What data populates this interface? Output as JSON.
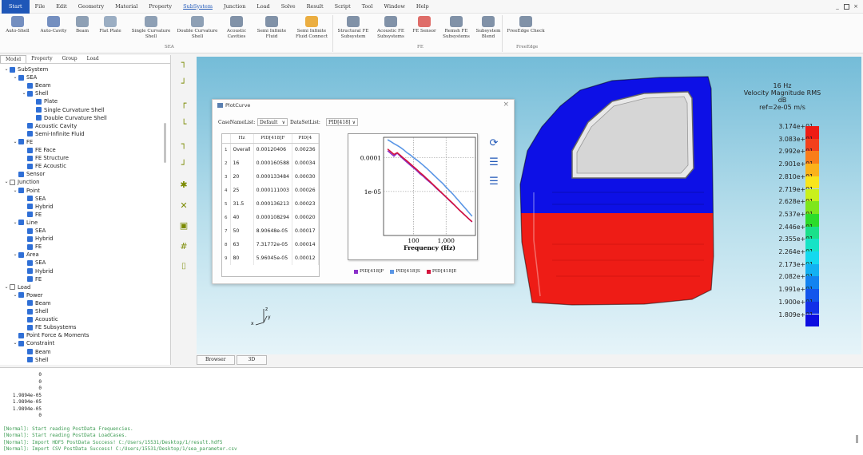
{
  "menu": {
    "items": [
      "Start",
      "File",
      "Edit",
      "Geometry",
      "Material",
      "Property",
      "SubSystem",
      "Junction",
      "Load",
      "Solve",
      "Result",
      "Script",
      "Tool",
      "Window",
      "Help"
    ],
    "window_buttons": [
      "_",
      "×"
    ]
  },
  "ribbon": {
    "buttons": [
      {
        "label": "Auto-Shell",
        "icon": "auto-shell-icon",
        "color": "#5c7bb5"
      },
      {
        "label": "Auto-Cavity",
        "icon": "auto-cavity-icon",
        "color": "#5c7bb5"
      },
      {
        "label": "Beam",
        "icon": "beam-icon",
        "color": "#7a8fa8"
      },
      {
        "label": "Flat Plate",
        "icon": "flat-plate-icon",
        "color": "#8aa0b8"
      },
      {
        "label": "Single Curvature Shell",
        "icon": "single-curvature-shell-icon",
        "color": "#7a8fa8"
      },
      {
        "label": "Double Curvature Shell",
        "icon": "double-curvature-shell-icon",
        "color": "#7a8fa8"
      },
      {
        "label": "Acoustic Cavities",
        "icon": "acoustic-cavities-icon",
        "color": "#6b7f99"
      },
      {
        "label": "Semi Infinite Fluid",
        "icon": "semi-infinite-fluid-icon",
        "color": "#6b7f99"
      },
      {
        "label": "Semi Infinite Fluid Connect",
        "icon": "semi-infinite-fluid-connect-icon",
        "color": "#e8a020"
      },
      {
        "label": "Structural FE Subsystem",
        "icon": "structural-fe-subsystem-icon",
        "color": "#6b7f99"
      },
      {
        "label": "Acoustic FE Subsystems",
        "icon": "acoustic-fe-subsystems-icon",
        "color": "#6b7f99"
      },
      {
        "label": "FE Sensor",
        "icon": "fe-sensor-icon",
        "color": "#d9534f"
      },
      {
        "label": "Remsh FE Subsystems",
        "icon": "remesh-fe-subsystems-icon",
        "color": "#6b7f99"
      },
      {
        "label": "Subsystem Blend",
        "icon": "subsystem-blend-icon",
        "color": "#6b7f99"
      },
      {
        "label": "FreeEdge Check",
        "icon": "freeedge-check-icon",
        "color": "#6b7f99"
      }
    ],
    "groups": [
      "SEA",
      "FE",
      "FreeEdge"
    ]
  },
  "tree": {
    "tabs": [
      "Model",
      "Property",
      "Group",
      "Load"
    ],
    "rows": [
      {
        "label": "SubSystem",
        "level": 0,
        "arrow": "v",
        "checked": true
      },
      {
        "label": "SEA",
        "level": 1,
        "arrow": "v",
        "checked": true
      },
      {
        "label": "Beam",
        "level": 2,
        "arrow": "",
        "checked": true
      },
      {
        "label": "Shell",
        "level": 2,
        "arrow": "v",
        "checked": true
      },
      {
        "label": "Plate",
        "level": 3,
        "arrow": "",
        "checked": true
      },
      {
        "label": "Single Curvature Shell",
        "level": 3,
        "arrow": "",
        "checked": true
      },
      {
        "label": "Double Curvature Shell",
        "level": 3,
        "arrow": "",
        "checked": true
      },
      {
        "label": "Acoustic Cavity",
        "level": 2,
        "arrow": "",
        "checked": true
      },
      {
        "label": "Semi-Infinite Fluid",
        "level": 2,
        "arrow": "",
        "checked": true
      },
      {
        "label": "FE",
        "level": 1,
        "arrow": "v",
        "checked": true
      },
      {
        "label": "FE Face",
        "level": 2,
        "arrow": "",
        "checked": true
      },
      {
        "label": "FE Structure",
        "level": 2,
        "arrow": "",
        "checked": true
      },
      {
        "label": "FE Acoustic",
        "level": 2,
        "arrow": "",
        "checked": true
      },
      {
        "label": "Sensor",
        "level": 1,
        "arrow": "",
        "checked": true
      },
      {
        "label": "Junction",
        "level": 0,
        "arrow": "v",
        "checked": false
      },
      {
        "label": "Point",
        "level": 1,
        "arrow": "v",
        "checked": true
      },
      {
        "label": "SEA",
        "level": 2,
        "arrow": "",
        "checked": true
      },
      {
        "label": "Hybrid",
        "level": 2,
        "arrow": "",
        "checked": true
      },
      {
        "label": "FE",
        "level": 2,
        "arrow": "",
        "checked": true
      },
      {
        "label": "Line",
        "level": 1,
        "arrow": "v",
        "checked": true
      },
      {
        "label": "SEA",
        "level": 2,
        "arrow": "",
        "checked": true
      },
      {
        "label": "Hybrid",
        "level": 2,
        "arrow": "",
        "checked": true
      },
      {
        "label": "FE",
        "level": 2,
        "arrow": "",
        "checked": true
      },
      {
        "label": "Area",
        "level": 1,
        "arrow": "v",
        "checked": true
      },
      {
        "label": "SEA",
        "level": 2,
        "arrow": "",
        "checked": true
      },
      {
        "label": "Hybrid",
        "level": 2,
        "arrow": "",
        "checked": true
      },
      {
        "label": "FE",
        "level": 2,
        "arrow": "",
        "checked": true
      },
      {
        "label": "Load",
        "level": 0,
        "arrow": "v",
        "checked": false
      },
      {
        "label": "Power",
        "level": 1,
        "arrow": "v",
        "checked": true
      },
      {
        "label": "Beam",
        "level": 2,
        "arrow": "",
        "checked": true
      },
      {
        "label": "Shell",
        "level": 2,
        "arrow": "",
        "checked": true
      },
      {
        "label": "Acoustic",
        "level": 2,
        "arrow": "",
        "checked": true
      },
      {
        "label": "FE Subsystems",
        "level": 2,
        "arrow": "",
        "checked": true
      },
      {
        "label": "Point Force & Moments",
        "level": 1,
        "arrow": "",
        "checked": true
      },
      {
        "label": "Constraint",
        "level": 1,
        "arrow": "v",
        "checked": true
      },
      {
        "label": "Beam",
        "level": 2,
        "arrow": "",
        "checked": true
      },
      {
        "label": "Shell",
        "level": 2,
        "arrow": "",
        "checked": true
      }
    ]
  },
  "tools": [
    "┐",
    "┘",
    "┌",
    "└",
    "┐",
    "┘",
    "✱",
    "✕",
    "▣",
    "#",
    "⌷"
  ],
  "viewport": {
    "tabs": [
      "Browser",
      "3D"
    ],
    "axes": {
      "z": "z",
      "y": "y",
      "x": "x"
    },
    "legend": {
      "title_lines": [
        "16 Hz",
        "Velocity Magnitude RMS",
        "dB",
        "ref=2e-05 m/s"
      ],
      "entries": [
        {
          "label": "3.174e+01",
          "color": "#ee1c14"
        },
        {
          "label": "3.083e+01",
          "color": "#f2401c"
        },
        {
          "label": "2.992e+01",
          "color": "#f97d1a"
        },
        {
          "label": "2.901e+01",
          "color": "#fbb21a"
        },
        {
          "label": "2.810e+01",
          "color": "#f9e51b"
        },
        {
          "label": "2.719e+01",
          "color": "#c9f01c"
        },
        {
          "label": "2.628e+01",
          "color": "#7ee61c"
        },
        {
          "label": "2.537e+01",
          "color": "#2bdc2a"
        },
        {
          "label": "2.446e+01",
          "color": "#19e08a"
        },
        {
          "label": "2.355e+01",
          "color": "#16e3c6"
        },
        {
          "label": "2.264e+01",
          "color": "#14d9ef"
        },
        {
          "label": "2.173e+01",
          "color": "#12b1f2"
        },
        {
          "label": "2.082e+01",
          "color": "#1283f0"
        },
        {
          "label": "1.991e+01",
          "color": "#1255ec"
        },
        {
          "label": "1.900e+01",
          "color": "#1230e8"
        },
        {
          "label": "1.809e+01",
          "color": "#0d0de0"
        }
      ]
    },
    "model_colors": {
      "top": "#0d10e6",
      "bottom": "#ee1c16",
      "frame": "#d8d8d8"
    }
  },
  "plotcurve": {
    "title": "PlotCurve",
    "close": "×",
    "case_label": "CaseNameList:",
    "case_value": "Default",
    "dataset_label": "DataSetList:",
    "dataset_value": "PID[418]",
    "table": {
      "headers": [
        "Hz",
        "PID[418]F",
        "PID[4"
      ],
      "rows": [
        {
          "idx": "1",
          "hz": "Overall",
          "f": "0.00120406",
          "s": "0.00236"
        },
        {
          "idx": "2",
          "hz": "16",
          "f": "0.000160588",
          "s": "0.00034"
        },
        {
          "idx": "3",
          "hz": "20",
          "f": "0.000133484",
          "s": "0.00030"
        },
        {
          "idx": "4",
          "hz": "25",
          "f": "0.000111003",
          "s": "0.00026"
        },
        {
          "idx": "5",
          "hz": "31.5",
          "f": "0.000136213",
          "s": "0.00023"
        },
        {
          "idx": "6",
          "hz": "40",
          "f": "0.000108294",
          "s": "0.00020"
        },
        {
          "idx": "7",
          "hz": "50",
          "f": "8.90648e-05",
          "s": "0.00017"
        },
        {
          "idx": "8",
          "hz": "63",
          "f": "7.31772e-05",
          "s": "0.00014"
        },
        {
          "idx": "9",
          "hz": "80",
          "f": "5.96045e-05",
          "s": "0.00012"
        }
      ]
    },
    "side_icons": [
      "refresh-icon",
      "list-icon",
      "list-icon"
    ]
  },
  "chart_data": {
    "type": "line",
    "title": "",
    "xlabel": "Frequency (Hz)",
    "ylabel": "",
    "x_scale": "log",
    "y_scale": "log",
    "xlim": [
      12,
      8000
    ],
    "ylim": [
      5e-07,
      0.0004
    ],
    "x_ticks": [
      {
        "value": 100,
        "label": "100"
      },
      {
        "value": 1000,
        "label": "1,000"
      }
    ],
    "y_ticks": [
      {
        "value": 0.0001,
        "label": "0.0001"
      },
      {
        "value": 1e-05,
        "label": "1e-05"
      }
    ],
    "grid": true,
    "legend_position": "bottom",
    "series": [
      {
        "name": "PID[418]F",
        "color": "#8a2fc9",
        "x": [
          16,
          20,
          25,
          31.5,
          40,
          50,
          63,
          80,
          100,
          125,
          160,
          200,
          250,
          315,
          400,
          500,
          630,
          800,
          1000,
          1250,
          1600,
          2000,
          2500,
          3150,
          4000,
          5000,
          6300
        ],
        "y": [
          0.000160588,
          0.000133484,
          0.000111003,
          0.000136213,
          0.000108294,
          8.90648e-05,
          7.31772e-05,
          5.96045e-05,
          5e-05,
          4.2e-05,
          3.3e-05,
          2.8e-05,
          2.3e-05,
          1.9e-05,
          1.55e-05,
          1.25e-05,
          1.02e-05,
          8.3e-06,
          6.8e-06,
          5.5e-06,
          4.4e-06,
          3.6e-06,
          2.9e-06,
          2.35e-06,
          1.9e-06,
          1.55e-06,
          1.25e-06
        ]
      },
      {
        "name": "PID[418]S",
        "color": "#5a96e6",
        "x": [
          16,
          20,
          25,
          31.5,
          40,
          50,
          63,
          80,
          100,
          125,
          160,
          200,
          250,
          315,
          400,
          500,
          630,
          800,
          1000,
          1250,
          1600,
          2000,
          2500,
          3150,
          4000,
          5000,
          6300
        ],
        "y": [
          0.00034,
          0.0003,
          0.00026,
          0.00023,
          0.0002,
          0.00017,
          0.00014,
          0.00012,
          0.0001,
          8.6e-05,
          7.1e-05,
          5.9e-05,
          4.9e-05,
          4e-05,
          3.2e-05,
          2.6e-05,
          2.1e-05,
          1.7e-05,
          1.35e-05,
          1.08e-05,
          8.5e-06,
          6.6e-06,
          5.2e-06,
          4e-06,
          3.1e-06,
          2.4e-06,
          1.85e-06
        ]
      },
      {
        "name": "PID[418]E",
        "color": "#d4143c",
        "x": [
          16,
          20,
          25,
          31.5,
          40,
          50,
          63,
          80,
          100,
          125,
          160,
          200,
          250,
          315,
          400,
          500,
          630,
          800,
          1000,
          1250,
          1600,
          2000,
          2500,
          3150,
          4000,
          5000,
          6300
        ],
        "y": [
          0.00018,
          0.00015,
          0.000125,
          0.00014,
          0.000115,
          9.6e-05,
          8e-05,
          6.5e-05,
          5.4e-05,
          4.5e-05,
          3.6e-05,
          3e-05,
          2.45e-05,
          2e-05,
          1.6e-05,
          1.3e-05,
          1.05e-05,
          8.5e-06,
          6.9e-06,
          5.6e-06,
          4.5e-06,
          3.6e-06,
          2.9e-06,
          2.35e-06,
          1.9e-06,
          1.55e-06,
          1.28e-06
        ]
      }
    ]
  },
  "console": {
    "lines": [
      {
        "text": "0",
        "color": "plain"
      },
      {
        "text": "0",
        "color": "plain"
      },
      {
        "text": "0",
        "color": "plain"
      },
      {
        "text": "1.9894e-05",
        "color": "plain"
      },
      {
        "text": "1.9894e-05",
        "color": "plain"
      },
      {
        "text": "1.9894e-05",
        "color": "plain"
      },
      {
        "text": "0",
        "color": "plain"
      },
      {
        "text": "[Normal]: Start reading PostData Frequencies.",
        "color": "green"
      },
      {
        "text": "[Normal]: Start reading PostData LoadCases.",
        "color": "green"
      },
      {
        "text": "[Normal]: Import HDF5 PostData Success! C:/Users/15531/Desktop/1/result.hdf5",
        "color": "green"
      },
      {
        "text": "[Normal]: Import CSV PostData Success! C:/Users/15531/Desktop/1/sea_parameter.csv",
        "color": "green"
      }
    ]
  }
}
